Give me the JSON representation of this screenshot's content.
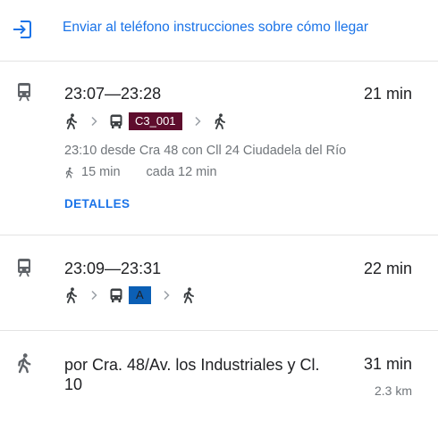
{
  "send": {
    "label": "Enviar al teléfono instrucciones sobre cómo llegar",
    "icon": "send-to-phone-icon",
    "color": "#1a73e8"
  },
  "routes": [
    {
      "mode_icon": "train-icon",
      "time_range": "23:07—23:28",
      "duration": "21 min",
      "steps": [
        "walk-icon",
        "bus-icon",
        "walk-icon"
      ],
      "line": {
        "label": "C3_001",
        "bg": "#5e0d2d",
        "fg": "#ffffff"
      },
      "departure": "23:10 desde Cra 48 con Cll 24 Ciudadela del Río",
      "walk_time": "15 min",
      "frequency": "cada 12 min",
      "details_label": "DETALLES"
    },
    {
      "mode_icon": "train-icon",
      "time_range": "23:09—23:31",
      "duration": "22 min",
      "steps": [
        "walk-icon",
        "bus-icon",
        "walk-icon"
      ],
      "line": {
        "label": "A",
        "bg": "#0b5fb5",
        "fg": "#202124"
      }
    },
    {
      "mode_icon": "walk-icon",
      "description": "por Cra. 48/Av. los Industriales y Cl. 10",
      "duration": "31 min",
      "distance": "2.3 km"
    }
  ]
}
